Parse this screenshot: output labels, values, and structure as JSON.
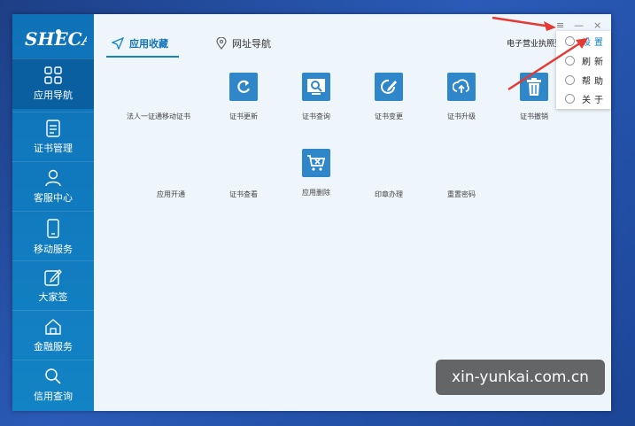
{
  "window": {
    "logo_text": "SHECA",
    "controls": {
      "menu": "≡",
      "minimize": "—",
      "close": "×"
    },
    "top_right_label": "电子营业执照登"
  },
  "sidebar": {
    "items": [
      {
        "label": "应用导航",
        "icon": "grid-icon"
      },
      {
        "label": "证书管理",
        "icon": "document-icon"
      },
      {
        "label": "客服中心",
        "icon": "user-icon"
      },
      {
        "label": "移动服务",
        "icon": "phone-icon"
      },
      {
        "label": "大家签",
        "icon": "edit-icon"
      },
      {
        "label": "金融服务",
        "icon": "home-icon"
      },
      {
        "label": "信用查询",
        "icon": "search-icon"
      }
    ]
  },
  "tabs": [
    {
      "label": "应用收藏",
      "icon": "send-icon",
      "active": true
    },
    {
      "label": "网址导航",
      "icon": "location-icon",
      "active": false
    }
  ],
  "apps": [
    {
      "label": "法人一证通移动证书",
      "icon": "none"
    },
    {
      "label": "证书更新",
      "icon": "refresh-icon"
    },
    {
      "label": "证书查询",
      "icon": "image-search-icon"
    },
    {
      "label": "证书变更",
      "icon": "edit-circle-icon"
    },
    {
      "label": "证书升级",
      "icon": "upload-icon"
    },
    {
      "label": "证书撤销",
      "icon": "trash-icon"
    },
    {
      "label": "应用开通",
      "icon": "none"
    },
    {
      "label": "证书查看",
      "icon": "none"
    },
    {
      "label": "应用删除",
      "icon": "cart-delete-icon"
    },
    {
      "label": "印章办理",
      "icon": "none"
    },
    {
      "label": "重置密码",
      "icon": "none"
    }
  ],
  "dropdown_menu": {
    "items": [
      {
        "label": "设置"
      },
      {
        "label": "刷新"
      },
      {
        "label": "帮助"
      },
      {
        "label": "关于"
      }
    ]
  },
  "watermark": {
    "text": "xin-yunkai.com.cn"
  },
  "colors": {
    "accent": "#1283c4",
    "arrow": "#e53935",
    "sidebar": "#0f72b8"
  }
}
